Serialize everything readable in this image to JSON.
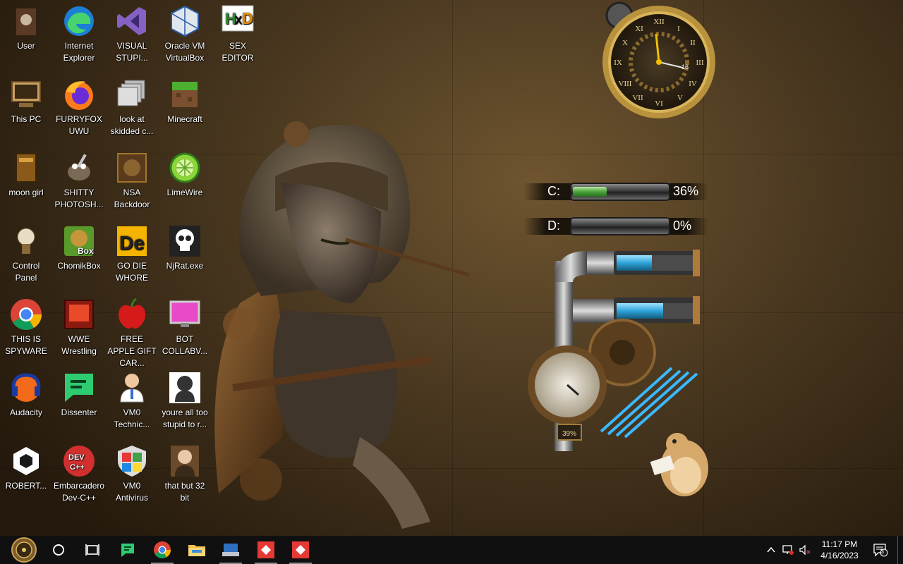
{
  "desktop": {
    "icons": [
      {
        "label": "User",
        "icon": "user-folder-icon"
      },
      {
        "label": "Internet Explorer",
        "icon": "edge-icon"
      },
      {
        "label": "VISUAL STUPI...",
        "icon": "visual-studio-icon"
      },
      {
        "label": "Oracle VM VirtualBox",
        "icon": "virtualbox-icon"
      },
      {
        "label": "SEX EDITOR",
        "icon": "hxd-editor-icon"
      },
      {
        "label": "This PC",
        "icon": "this-pc-icon"
      },
      {
        "label": "FURRYFOX UWU",
        "icon": "firefox-icon"
      },
      {
        "label": "look at skidded c...",
        "icon": "folder-stack-icon"
      },
      {
        "label": "Minecraft",
        "icon": "minecraft-icon"
      },
      {
        "label": "moon girl",
        "icon": "book-icon"
      },
      {
        "label": "SHITTY PHOTOSH...",
        "icon": "gimp-icon"
      },
      {
        "label": "NSA Backdoor",
        "icon": "steampunk-app-icon"
      },
      {
        "label": "LimeWire",
        "icon": "limewire-icon"
      },
      {
        "label": "Control Panel",
        "icon": "control-panel-icon"
      },
      {
        "label": "ChomikBox",
        "icon": "chomikbox-icon"
      },
      {
        "label": "GO DIE WHORE",
        "icon": "de-app-icon"
      },
      {
        "label": "NjRat.exe",
        "icon": "skull-icon"
      },
      {
        "label": "THIS IS SPYWARE",
        "icon": "chrome-icon"
      },
      {
        "label": "WWE Wrestling",
        "icon": "wwe-game-icon"
      },
      {
        "label": "FREE APPLE GIFT CAR...",
        "icon": "apple-icon"
      },
      {
        "label": "BOT COLLABV...",
        "icon": "monitor-icon"
      },
      {
        "label": "Audacity",
        "icon": "audacity-icon"
      },
      {
        "label": "Dissenter",
        "icon": "dissenter-icon"
      },
      {
        "label": "VM0 Technic...",
        "icon": "doctor-icon"
      },
      {
        "label": "youre all too stupid to r...",
        "icon": "portrait-icon"
      },
      {
        "label": "ROBERT...",
        "icon": "unity-icon"
      },
      {
        "label": "Embarcadero Dev-C++",
        "icon": "devcpp-icon"
      },
      {
        "label": "VM0 Antivirus",
        "icon": "windows-shield-icon"
      },
      {
        "label": "that but 32 bit",
        "icon": "painting-icon"
      }
    ]
  },
  "widgets": {
    "disk_c": {
      "letter": "C:",
      "percent_text": "36%",
      "fill": 0.36
    },
    "disk_d": {
      "letter": "D:",
      "percent_text": "0%",
      "fill": 0.0
    },
    "gauge_text": "39%"
  },
  "taskbar": {
    "clock_time": "11:17 PM",
    "clock_date": "4/16/2023",
    "notification_count": "3"
  },
  "colors": {
    "taskbar_bg": "#101010",
    "wallpaper_brown": "#6f5530",
    "meter_green": "#4aa33a",
    "tube_blue": "#2ea3d8",
    "dev_red": "#d32f2f"
  }
}
